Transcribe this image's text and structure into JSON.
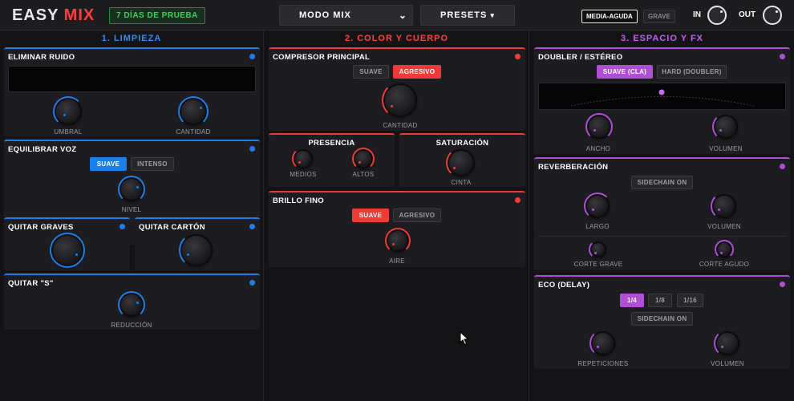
{
  "header": {
    "logo_easy": "EASY",
    "logo_mix": "MIX",
    "trial": "7 DÍAS DE PRUEBA",
    "mode_select": "MODO MIX",
    "presets": "PRESETS",
    "presets_arrow": "▾",
    "mode_chevron": "⌄",
    "tone_on": "MEDIA-AGUDA",
    "tone_off": "GRAVE",
    "in_label": "IN",
    "out_label": "OUT"
  },
  "colors": {
    "blue": "#1a7fe8",
    "red": "#f03a35",
    "purple": "#b04ed8"
  },
  "col1": {
    "title": "1. LIMPIEZA",
    "noise": {
      "title": "ELIMINAR RUIDO",
      "k1": "UMBRAL",
      "k2": "CANTIDAD"
    },
    "voice": {
      "title": "EQUILIBRAR VOZ",
      "b1": "SUAVE",
      "b2": "INTENSO",
      "k1": "NIVEL"
    },
    "bass": {
      "title": "QUITAR GRAVES"
    },
    "carton": {
      "title": "QUITAR CARTÓN"
    },
    "ess": {
      "title": "QUITAR \"S\"",
      "k1": "REDUCCIÓN"
    }
  },
  "col2": {
    "title": "2. COLOR Y CUERPO",
    "comp": {
      "title": "COMPRESOR PRINCIPAL",
      "b1": "SUAVE",
      "b2": "AGRESIVO",
      "k1": "CANTIDAD"
    },
    "presence": {
      "title": "PRESENCIA",
      "k1": "MEDIOS",
      "k2": "ALTOS"
    },
    "saturation": {
      "title": "SATURACIÓN",
      "k1": "CINTA"
    },
    "bright": {
      "title": "BRILLO FINO",
      "b1": "SUAVE",
      "b2": "AGRESIVO",
      "k1": "AIRE"
    }
  },
  "col3": {
    "title": "3. ESPACIO Y FX",
    "doubler": {
      "title": "DOUBLER / ESTÉREO",
      "b1": "SUAVE (CLA)",
      "b2": "HARD (DOUBLER)",
      "k1": "ANCHO",
      "k2": "VOLUMEN"
    },
    "reverb": {
      "title": "REVERBERACIÓN",
      "sidechain": "SIDECHAIN ON",
      "k1": "LARGO",
      "k2": "VOLUMEN",
      "k3": "CORTE GRAVE",
      "k4": "CORTE AGUDO"
    },
    "echo": {
      "title": "ECO (DELAY)",
      "b1": "1/4",
      "b2": "1/8",
      "b3": "1/16",
      "sidechain": "SIDECHAIN ON",
      "k1": "REPETICIONES",
      "k2": "VOLUMEN"
    }
  }
}
